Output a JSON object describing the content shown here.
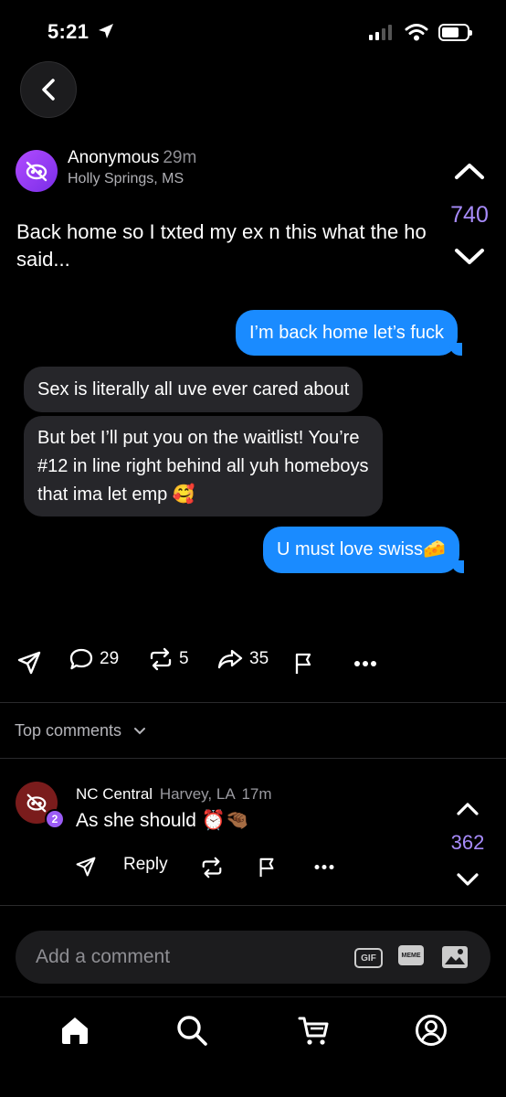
{
  "status_bar": {
    "time": "5:21"
  },
  "post": {
    "author": "Anonymous",
    "time_ago": "29m",
    "location": "Holly Springs, MS",
    "score": "740",
    "text": "Back home so I txted my ex n this what the ho said...",
    "messages": [
      {
        "side": "sent",
        "text": "I’m back home let’s fuck"
      },
      {
        "side": "received",
        "text": "Sex is literally all uve ever cared about"
      },
      {
        "side": "received",
        "text": "But bet I’ll put you on the waitlist! You’re #12 in line right behind all yuh homeboys that ima let emp 🥰"
      },
      {
        "side": "sent",
        "text": "U must love swiss🧀"
      }
    ],
    "actions": {
      "comments": "29",
      "reposts": "5",
      "shares": "35"
    }
  },
  "comments_section": {
    "sort_label": "Top comments",
    "comments": [
      {
        "author": "NC Central",
        "location": "Harvey, LA",
        "time_ago": "17m",
        "badge": "2",
        "text": "As she should ⏰🤏🏾",
        "score": "362",
        "reply_label": "Reply"
      }
    ]
  },
  "composer": {
    "placeholder": "Add a comment",
    "gif_label": "GIF",
    "meme_label": "MEME"
  },
  "tabbar": {
    "items": [
      "home-icon",
      "search-icon",
      "cart-icon",
      "profile-icon"
    ]
  },
  "colors": {
    "accent": "#a78bfa",
    "sent_bubble": "#1a8bff",
    "received_bubble": "#26262a"
  }
}
